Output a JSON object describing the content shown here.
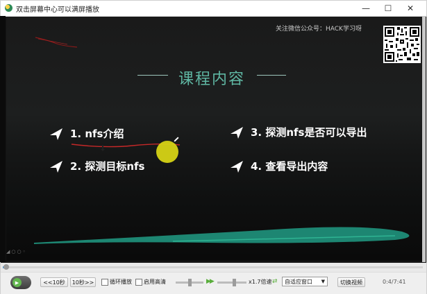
{
  "window": {
    "title": "双击屏幕中心可以满屏播放"
  },
  "slide": {
    "follow": "关注微信公众号：HACK学习呀",
    "title": "课程内容",
    "items": [
      {
        "label": "1.  nfs介绍"
      },
      {
        "label": "2.  探测目标nfs"
      },
      {
        "label": "3. 探测nfs是否可以导出"
      },
      {
        "label": "4. 查看导出内容"
      }
    ]
  },
  "progress": {
    "fraction": 0.01
  },
  "controls": {
    "back_label": "<<10秒",
    "forward_label": "10秒>>",
    "loop_label": "循环播放",
    "hd_label": "启用高清",
    "speed_label": "x1.7倍速",
    "window_mode": "自适应窗口",
    "switch_label": "切换视频",
    "time": "0:4/7:41"
  },
  "colors": {
    "accent": "#5fb7a3",
    "highlight": "#d6d315",
    "play": "#62b64e",
    "wave": "#1f8d78"
  }
}
